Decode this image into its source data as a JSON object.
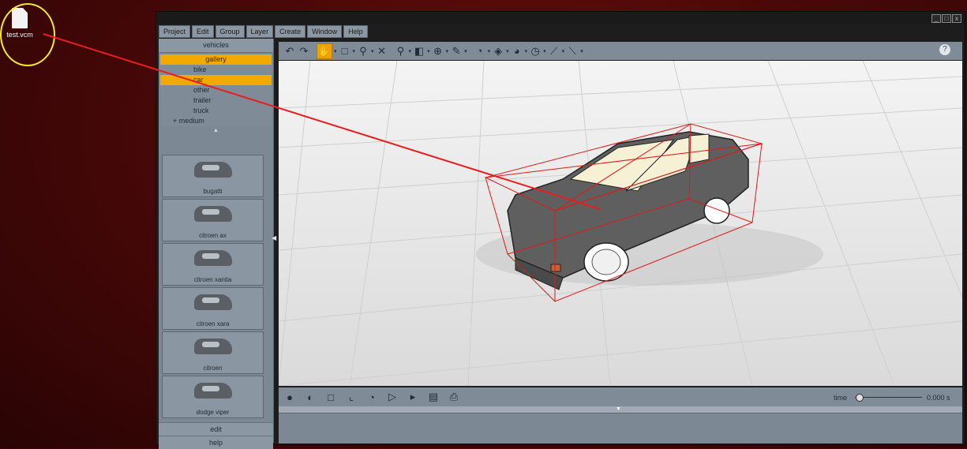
{
  "desktop": {
    "file_label": "test.vcm"
  },
  "menu": {
    "items": [
      "Project",
      "Edit",
      "Group",
      "Layer",
      "Create",
      "Window",
      "Help"
    ]
  },
  "window_controls": [
    "_",
    "□",
    "x"
  ],
  "sidebar": {
    "header": "vehicles",
    "categories": {
      "gallery": "gallery",
      "bike": "bike",
      "car": "car",
      "other": "other",
      "trailer": "trailer",
      "truck": "truck",
      "medium": "medium"
    },
    "thumbnails": [
      "bugatti",
      "citroen ax",
      "citroen xantia",
      "citroen xara",
      "citroen",
      "dodge viper"
    ],
    "buttons": {
      "edit": "edit",
      "help": "help"
    }
  },
  "timeline": {
    "label": "time",
    "value": "0.000 s",
    "position": 0
  },
  "colors": {
    "accent": "#f2a900",
    "panel": "#7f8b97",
    "annotation": "#e81e1e",
    "ring": "#f4ea2a"
  },
  "icons": {
    "toolbar": [
      "undo-icon",
      "redo-icon",
      "pan-hand-icon",
      "select-box-icon",
      "transform-icon",
      "delete-icon",
      "zoom-icon",
      "cube-icon",
      "orbit-icon",
      "pen-icon",
      "gauge-icon",
      "tag-icon",
      "dial-icon",
      "rotate-icon",
      "path-icon",
      "ruler-icon"
    ],
    "help": "help-icon"
  }
}
